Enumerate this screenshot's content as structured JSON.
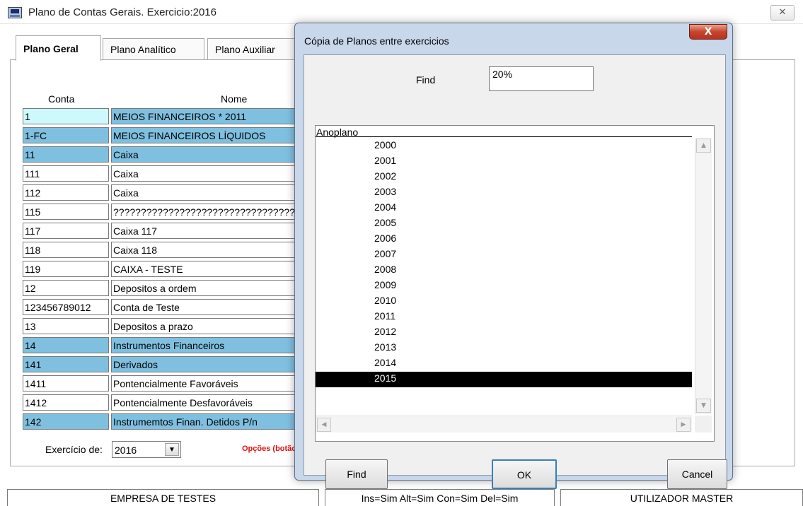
{
  "main_window": {
    "title": "Plano de Contas Gerais.  Exercicio:2016",
    "close_glyph": "✕"
  },
  "tabs": [
    {
      "label": "Plano Geral",
      "active": true
    },
    {
      "label": "Plano Analítico",
      "active": false
    },
    {
      "label": "Plano Auxiliar",
      "active": false
    }
  ],
  "grid": {
    "headers": {
      "conta": "Conta",
      "nome": "Nome"
    },
    "rows": [
      {
        "conta": "1",
        "nome": "MEIOS FINANCEIROS * 2011",
        "style": "selected"
      },
      {
        "conta": "1-FC",
        "nome": "MEIOS FINANCEIROS LÍQUIDOS",
        "style": "highlight"
      },
      {
        "conta": "11",
        "nome": "Caixa",
        "style": "highlight"
      },
      {
        "conta": "111",
        "nome": "Caixa",
        "style": "normal"
      },
      {
        "conta": "112",
        "nome": "Caixa",
        "style": "normal"
      },
      {
        "conta": "115",
        "nome": "?????????????????????????????????????",
        "style": "normal"
      },
      {
        "conta": "117",
        "nome": "Caixa 117",
        "style": "normal"
      },
      {
        "conta": "118",
        "nome": "Caixa 118",
        "style": "normal"
      },
      {
        "conta": "119",
        "nome": "CAIXA - TESTE",
        "style": "normal"
      },
      {
        "conta": "12",
        "nome": "Depositos a ordem",
        "style": "normal"
      },
      {
        "conta": "123456789012",
        "nome": "Conta de Teste",
        "style": "normal"
      },
      {
        "conta": "13",
        "nome": "Depositos a prazo",
        "style": "normal"
      },
      {
        "conta": "14",
        "nome": "Instrumentos Financeiros",
        "style": "highlight"
      },
      {
        "conta": "141",
        "nome": "Derivados",
        "style": "highlight"
      },
      {
        "conta": "1411",
        "nome": "Pontencialmente Favoráveis",
        "style": "normal"
      },
      {
        "conta": "1412",
        "nome": "Pontencialmente Desfavoráveis",
        "style": "normal"
      },
      {
        "conta": "142",
        "nome": "Instrumemtos Finan. Detidos P/n",
        "style": "highlight"
      }
    ]
  },
  "exercicio": {
    "label": "Exercício de:",
    "selected": "2016",
    "dropdown_glyph": "▼"
  },
  "opcoes_text": "Opções (botão",
  "status_bar": {
    "empresa": "EMPRESA DE TESTES",
    "permissions": "Ins=Sim Alt=Sim Con=Sim Del=Sim",
    "user": "UTILIZADOR MASTER"
  },
  "dialog": {
    "title": "Cópia de Planos entre exercicios",
    "close_glyph": "X",
    "find_label": "Find",
    "find_value": "20%",
    "list_header": "Anoplano",
    "years": [
      "2000",
      "2001",
      "2002",
      "2003",
      "2004",
      "2005",
      "2006",
      "2007",
      "2008",
      "2009",
      "2010",
      "2011",
      "2012",
      "2013",
      "2014",
      "2015"
    ],
    "selected_year": "2015",
    "scroll_up_glyph": "▲",
    "scroll_down_glyph": "▼",
    "scroll_left_glyph": "◀",
    "scroll_right_glyph": "▶",
    "buttons": {
      "find": "Find",
      "ok": "OK",
      "cancel": "Cancel"
    }
  }
}
